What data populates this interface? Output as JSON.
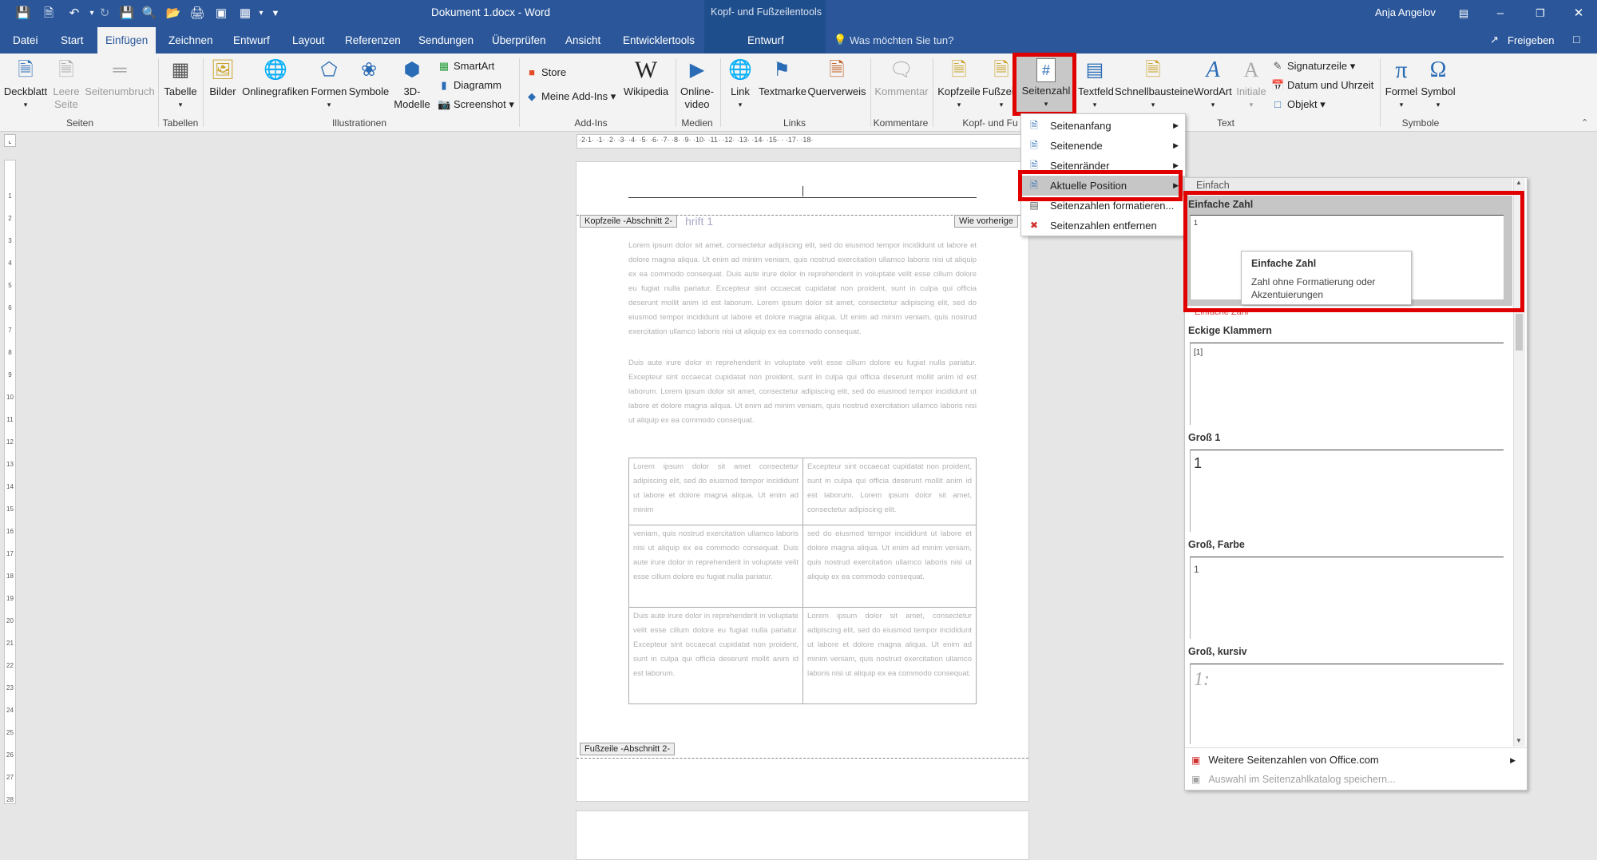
{
  "window": {
    "title": "Dokument 1.docx  -  Word",
    "context_title": "Kopf- und Fußzeilentools",
    "user": "Anja Angelov"
  },
  "tabs": [
    "Datei",
    "Start",
    "Einfügen",
    "Zeichnen",
    "Entwurf",
    "Layout",
    "Referenzen",
    "Sendungen",
    "Überprüfen",
    "Ansicht",
    "Entwicklertools"
  ],
  "context_tab": "Entwurf",
  "tell_me": "Was möchten Sie tun?",
  "share": "Freigeben",
  "ribbon": {
    "deckblatt": "Deckblatt",
    "leere_seite": [
      "Leere",
      "Seite"
    ],
    "seitenumbruch": "Seitenumbruch",
    "tabelle": "Tabelle",
    "bilder": "Bilder",
    "onlinegrafiken": "Onlinegrafiken",
    "formen": "Formen",
    "symbole": "Symbole",
    "dreid": [
      "3D-",
      "Modelle"
    ],
    "smartart": "SmartArt",
    "diagramm": "Diagramm",
    "screenshot": "Screenshot",
    "store": "Store",
    "meine_addins": "Meine Add-Ins",
    "wikipedia": "Wikipedia",
    "onlinevideo": [
      "Online-",
      "video"
    ],
    "link": "Link",
    "textmarke": "Textmarke",
    "querverweis": "Querverweis",
    "kommentar": "Kommentar",
    "kopfzeile": "Kopfzeile",
    "fusszeile": "Fußzeile",
    "seitenzahl": "Seitenzahl",
    "textfeld": "Textfeld",
    "schnellbausteine": "Schnellbausteine",
    "wordart": "WordArt",
    "initiale": "Initiale",
    "signaturzeile": "Signaturzeile",
    "datum": "Datum und Uhrzeit",
    "objekt": "Objekt",
    "formel": "Formel",
    "symbol": "Symbol",
    "groups": {
      "seiten": "Seiten",
      "tabellen": "Tabellen",
      "illustrationen": "Illustrationen",
      "addins": "Add-Ins",
      "medien": "Medien",
      "links": "Links",
      "kommentare": "Kommentare",
      "kopf": "Kopf- und Fu",
      "text": "Text",
      "symbole": "Symbole"
    }
  },
  "document": {
    "header_tag": "Kopfzeile -Abschnitt 2-",
    "wie_vorherige": "Wie vorherige",
    "heading": "hrift 1",
    "footer_tag": "Fußzeile -Abschnitt 2-",
    "para1": "Lorem ipsum dolor sit amet, consectetur adipiscing elit, sed do eiusmod tempor incididunt ut labore et dolore magna aliqua. Ut enim ad minim veniam, quis nostrud exercitation ullamco laboris nisi ut aliquip ex ea commodo consequat. Duis aute irure dolor in reprehenderit in voluptate velit esse cillum dolore eu fugiat nulla pariatur. Excepteur sint occaecat cupidatat non proident, sunt in culpa qui officia deserunt mollit anim id est laborum. Lorem ipsum dolor sit amet, consectetur adipiscing elit, sed do eiusmod tempor incididunt ut labore et dolore magna aliqua. Ut enim ad minim veniam, quis nostrud exercitation ullamco laboris nisi ut aliquip ex ea commodo consequat.",
    "para2": "Duis aute irure dolor in reprehenderit in voluptate velit esse cillum dolore eu fugiat nulla pariatur. Excepteur sint occaecat cupidatat non proident, sunt in culpa qui officia deserunt mollit anim id est laborum. Lorem ipsum dolor sit amet, consectetur adipiscing elit, sed do eiusmod tempor incididunt ut labore et dolore magna aliqua. Ut enim ad minim veniam, quis nostrud exercitation ullamco laboris nisi ut aliquip ex ea commodo consequat.",
    "table": [
      [
        "Lorem ipsum dolor sit amet consectetur adipiscing elit, sed do eiusmod tempor incididunt ut labore et dolore magna aliqua. Ut enim ad minim",
        "Excepteur sint occaecat cupidatat non proident, sunt in culpa qui officia deserunt mollit anim id est laborum. Lorem ipsum dolor sit amet, consectetur adipiscing elit."
      ],
      [
        "veniam, quis nostrud exercitation ullamco laboris nisi ut aliquip ex ea commodo consequat. Duis aute irure dolor in reprehenderit in voluptate velit esse cillum dolore eu fugiat nulla pariatur.",
        "sed do eiusmod tempor incididunt ut labore et dolore magna aliqua. Ut enim ad minim veniam, quis nostrud exercitation ullamco laboris nisi ut aliquip ex ea commodo consequat."
      ],
      [
        "Duis aute irure dolor in reprehenderit in voluptate velit esse cillum dolore eu fugiat nulla pariatur. Excepteur sint occaecat cupidatat non proident, sunt in culpa qui officia deserunt mollit anim id est laborum.",
        "Lorem ipsum dolor sit amet, consectetur adipiscing elit, sed do eiusmod tempor incididunt ut labore et dolore magna aliqua. Ut enim ad minim veniam, quis nostrud exercitation ullamco laboris nisi ut aliquip ex ea commodo consequat."
      ]
    ]
  },
  "menu": {
    "items": [
      "Seitenanfang",
      "Seitenende",
      "Seitenränder",
      "Aktuelle Position",
      "Seitenzahlen formatieren...",
      "Seitenzahlen entfernen"
    ]
  },
  "gallery": {
    "category": "Einfach",
    "items": [
      "Einfache Zahl",
      "Eckige Klammern",
      "Groß 1",
      "Groß, Farbe",
      "Groß, kursiv"
    ],
    "samples": [
      "1",
      "[1]",
      "1",
      "1",
      "1:"
    ],
    "partial_label": "Einfache Zahl",
    "more": "Weitere Seitenzahlen von Office.com",
    "save": "Auswahl im Seitenzahlkatalog speichern..."
  },
  "tooltip": {
    "title": "Einfache Zahl",
    "desc": "Zahl ohne Formatierung oder Akzentuierungen"
  },
  "ruler": {
    "h_text": "·2·1·  ·1·  ·2·  ·3·  ·4·  ·5·  ·6·  ·7·  ·8·  ·9·  ·10·  ·11·  ·12·  ·13·  ·14·  ·15·  ·  ·17·  ·18·",
    "v_numbers": [
      "1",
      "2",
      "3",
      "4",
      "5",
      "6",
      "7",
      "8",
      "9",
      "10",
      "11",
      "12",
      "13",
      "14",
      "15",
      "16",
      "17",
      "18",
      "19",
      "20",
      "21",
      "22",
      "23",
      "24",
      "25",
      "26",
      "27",
      "28"
    ]
  },
  "colors": {
    "accent": "#2b579a",
    "highlight": "#e00000"
  }
}
